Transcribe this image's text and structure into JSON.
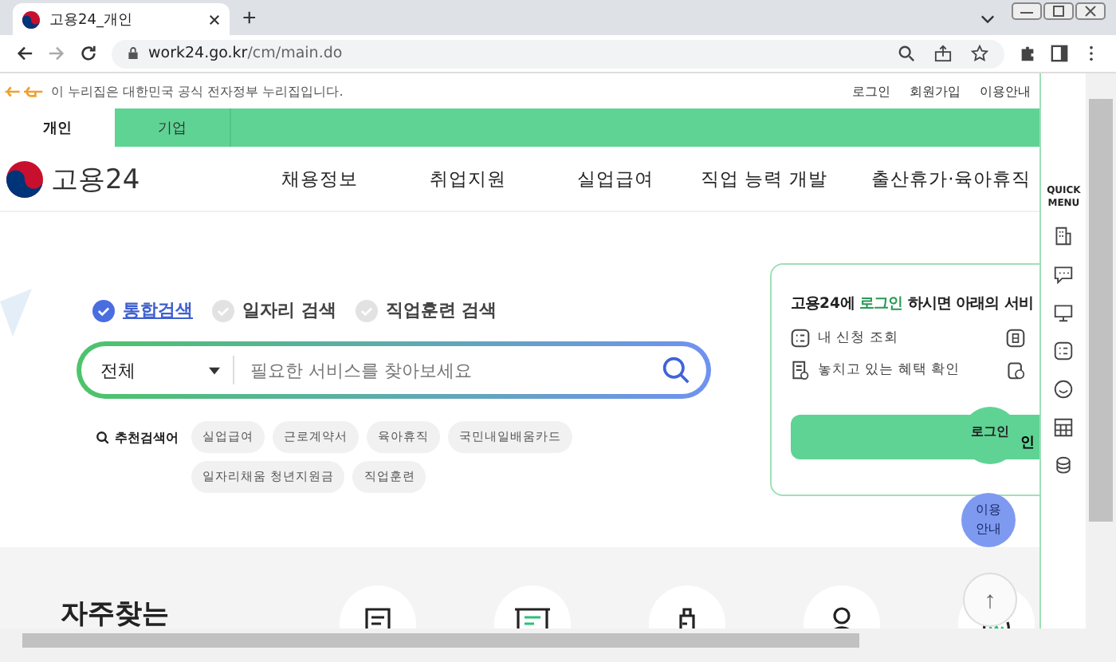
{
  "browser": {
    "tab_title": "고용24_개인",
    "new_tab": "+",
    "url_host": "work24.go.kr",
    "url_path": "/cm/main.do"
  },
  "gov_banner": {
    "text": "이 누리집은 대한민국 공식 전자정부 누리집입니다.",
    "links": [
      "로그인",
      "회원가입",
      "이용안내"
    ]
  },
  "user_tabs": [
    {
      "label": "개인",
      "selected": true
    },
    {
      "label": "기업",
      "selected": false
    }
  ],
  "logo": {
    "text": "고용24"
  },
  "nav": [
    "채용정보",
    "취업지원",
    "실업급여",
    "직업 능력 개발",
    "출산휴가·육아휴직"
  ],
  "search_types": [
    {
      "label": "통합검색",
      "selected": true
    },
    {
      "label": "일자리 검색",
      "selected": false
    },
    {
      "label": "직업훈련 검색",
      "selected": false
    }
  ],
  "search": {
    "category": "전체",
    "placeholder": "필요한 서비스를 찾아보세요"
  },
  "recommended": {
    "label": "추천검색어",
    "tags": [
      "실업급여",
      "근로계약서",
      "육아휴직",
      "국민내일배움카드",
      "일자리채움 청년지원금",
      "직업훈련"
    ]
  },
  "login_card": {
    "title_before": "고용24에 ",
    "title_link": "로그인",
    "title_after": " 하시면 아래의 서비",
    "items": [
      "내 신청 조회",
      "놓치고 있는 혜택 확인"
    ],
    "button": "인"
  },
  "floating": {
    "login": "로그인",
    "guide": [
      "이용",
      "안내"
    ],
    "top": "↑"
  },
  "quick_menu": {
    "title": [
      "QUICK",
      "MENU"
    ]
  },
  "frequent": {
    "title": "자주찾는"
  }
}
